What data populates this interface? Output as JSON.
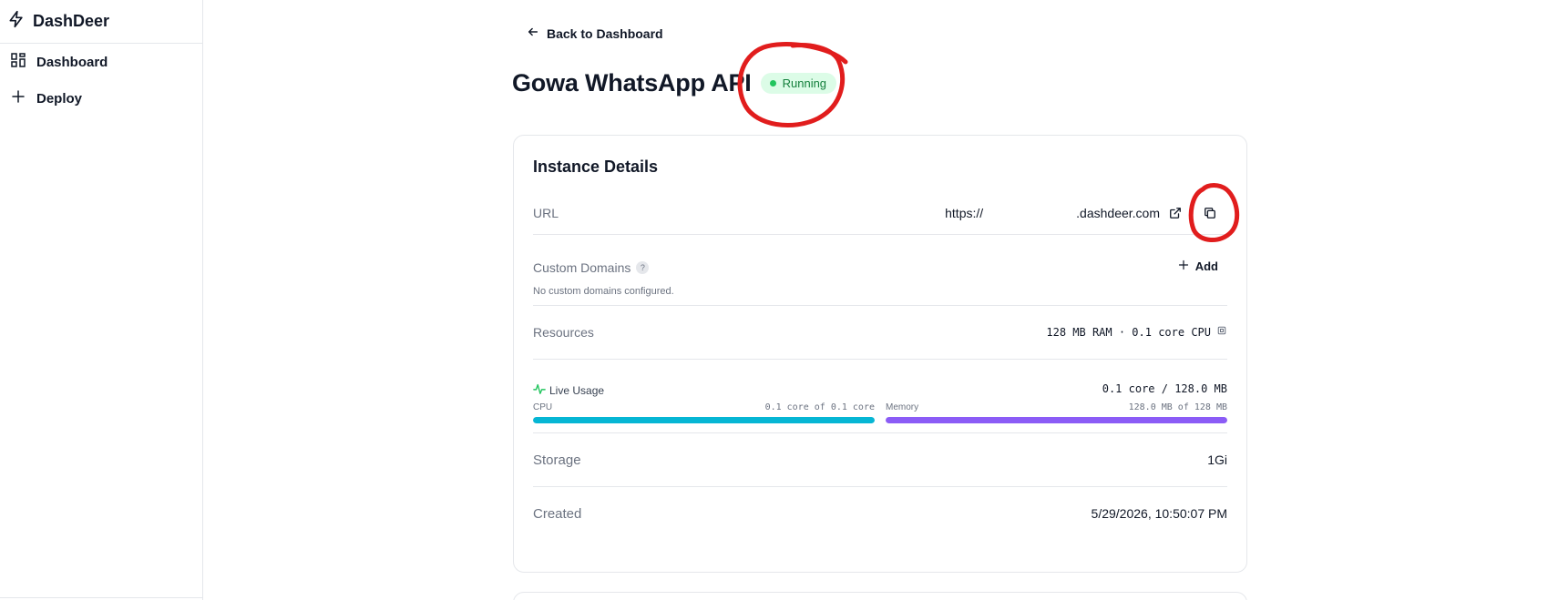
{
  "sidebar": {
    "brand": "DashDeer",
    "items": [
      {
        "label": "Dashboard",
        "icon": "grid-icon"
      },
      {
        "label": "Deploy",
        "icon": "plus-icon"
      }
    ]
  },
  "main": {
    "back_label": "Back to Dashboard",
    "title": "Gowa WhatsApp API",
    "status": "Running"
  },
  "details": {
    "title": "Instance Details",
    "url_label": "URL",
    "url_prefix": "https://",
    "url_suffix": ".dashdeer.com",
    "custom_domains_label": "Custom Domains",
    "custom_domains_help": "?",
    "custom_domains_empty": "No custom domains configured.",
    "add_label": "Add",
    "resources_label": "Resources",
    "resources_value": "128 MB RAM · 0.1 core CPU",
    "live_usage_label": "Live Usage",
    "live_usage_total": "0.1 core / 128.0 MB",
    "cpu_label": "CPU",
    "cpu_value": "0.1 core of 0.1 core",
    "cpu_fraction": 1.0,
    "memory_label": "Memory",
    "memory_value": "128.0 MB of 128 MB",
    "memory_fraction": 1.0,
    "storage_label": "Storage",
    "storage_value": "1Gi",
    "created_label": "Created",
    "created_value": "5/29/2026, 10:50:07 PM"
  },
  "colors": {
    "cpu_bar": "#06b6d4",
    "memory_bar": "#8b5cf6",
    "status_green": "#22c55e",
    "annotation_red": "#e11d1d"
  }
}
